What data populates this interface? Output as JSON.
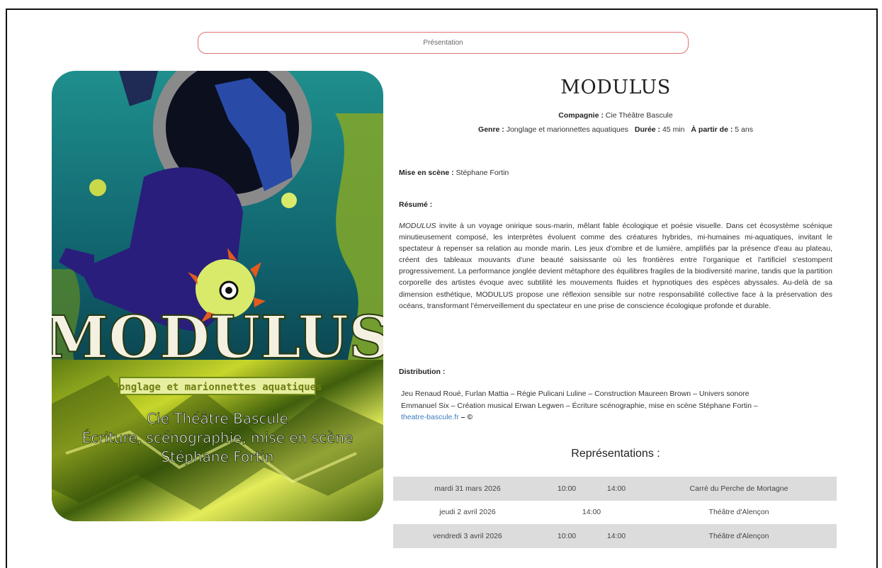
{
  "nav": {
    "presentation_label": "Présentation"
  },
  "poster": {
    "title": "MODULUS",
    "tag": "Jonglage et marionnettes aquatiques",
    "company": "Cie Théâtre Bascule",
    "credit1": "Écriture, scénographie, mise en scène",
    "credit2": "Stéphane Fortin"
  },
  "show": {
    "title": "MODULUS",
    "company_label": "Compagnie :",
    "company": "Cie Théâtre Bascule",
    "genre_label": "Genre :",
    "genre": "Jonglage et marionnettes aquatiques",
    "duration_label": "Durée :",
    "duration": "45 min",
    "age_label": "À partir de :",
    "age": "5 ans",
    "director_label": "Mise en scène :",
    "director": "Stéphane Fortin",
    "summary_label": "Résumé :",
    "summary_title": "MODULUS",
    "summary_text": " invite à un voyage onirique sous-marin, mêlant fable écologique et poésie visuelle. Dans cet écosystème scénique minutieusement composé, les interprètes évoluent comme des créatures hybrides, mi-humaines mi-aquatiques, invitant le spectateur à repenser sa relation au monde marin. Les jeux d'ombre et de lumière, amplifiés par la présence d'eau au plateau, créent des tableaux mouvants d'une beauté saisissante où les frontières entre l'organique et l'artificiel s'estompent progressivement. La performance jonglée devient métaphore des équilibres fragiles de la biodiversité marine, tandis que la partition corporelle des artistes évoque avec subtilité les mouvements fluides et hypnotiques des espèces abyssales. Au-delà de sa dimension esthétique, MODULUS propose une réflexion sensible sur notre responsabilité collective face à la préservation des océans, transformant l'émerveillement du spectateur en une prise de conscience écologique profonde et durable.",
    "distribution_label": "Distribution :",
    "distribution_line1": "Jeu Renaud Roué, Furlan Mattia – Régie Pulicani Luline – Construction Maureen Brown – Univers sonore",
    "distribution_line2": "Emmanuel Six – Création musical Erwan Legwen – Écriture scénographie, mise en scène Stéphane Fortin –",
    "distribution_link": "theatre-bascule.fr",
    "distribution_tail": " – ©"
  },
  "representations": {
    "heading": "Représentations :",
    "rows": [
      {
        "date": "mardi 31 mars 2026",
        "time1": "10:00",
        "time2": "14:00",
        "venue": "Carré du Perche de Mortagne"
      },
      {
        "date": "jeudi 2 avril 2026",
        "time": "14:00",
        "venue": "Théâtre d'Alençon"
      },
      {
        "date": "vendredi 3 avril 2026",
        "time1": "10:00",
        "time2": "14:00",
        "venue": "Théâtre d'Alençon"
      }
    ]
  }
}
